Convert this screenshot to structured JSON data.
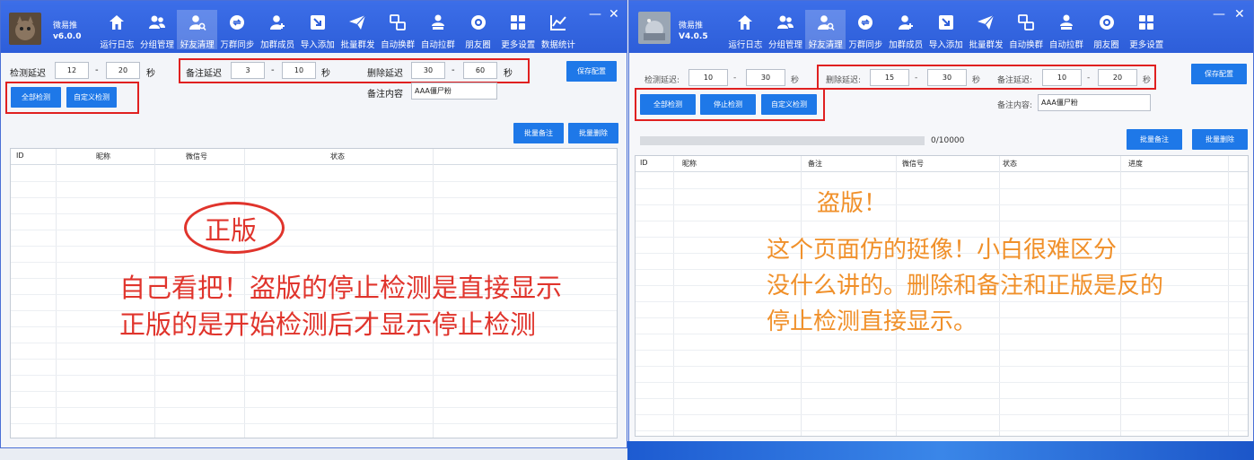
{
  "left": {
    "app_name": "微易推",
    "version": "v6.0.0",
    "nav": [
      "运行日志",
      "分组管理",
      "好友清理",
      "万群同步",
      "加群成员",
      "导入添加",
      "批量群发",
      "自动换群",
      "自动拉群",
      "朋友圈",
      "更多设置",
      "数据统计"
    ],
    "active_nav": "好友清理",
    "min": "—",
    "close": "✕",
    "check_delay_label": "检测延迟",
    "check_delay_from": "12",
    "check_delay_to": "20",
    "remark_delay_label": "备注延迟",
    "remark_delay_from": "3",
    "remark_delay_to": "10",
    "delete_delay_label": "删除延迟",
    "delete_delay_from": "30",
    "delete_delay_to": "60",
    "sec": "秒",
    "dash": "-",
    "save_btn": "保存配置",
    "check_all_btn": "全部检测",
    "custom_check_btn": "自定义检测",
    "remark_content_label": "备注内容",
    "remark_content_value": "AAA僵尸粉",
    "batch_remark_btn": "批量备注",
    "batch_delete_btn": "批量删除",
    "columns": [
      "ID",
      "昵称",
      "微信号",
      "状态"
    ],
    "ann_title": "正版",
    "ann_line1": "自己看把！盗版的停止检测是直接显示",
    "ann_line2": "正版的是开始检测后才显示停止检测"
  },
  "right": {
    "app_name": "微易推",
    "version": "V4.0.5",
    "nav": [
      "运行日志",
      "分组管理",
      "好友清理",
      "万群同步",
      "加群成员",
      "导入添加",
      "批量群发",
      "自动换群",
      "自动拉群",
      "朋友圈",
      "更多设置"
    ],
    "active_nav": "好友清理",
    "min": "—",
    "close": "✕",
    "check_delay_label": "检测延迟:",
    "check_delay_from": "10",
    "check_delay_to": "30",
    "delete_delay_label": "删除延迟:",
    "delete_delay_from": "15",
    "delete_delay_to": "30",
    "remark_delay_label": "备注延迟:",
    "remark_delay_from": "10",
    "remark_delay_to": "20",
    "sec": "秒",
    "dash": "-",
    "save_btn": "保存配置",
    "check_all_btn": "全部检测",
    "stop_check_btn": "停止检测",
    "custom_check_btn": "自定义检测",
    "remark_content_label": "备注内容:",
    "remark_content_value": "AAA僵尸粉",
    "progress_text": "0/10000",
    "progress": 0,
    "batch_remark_btn": "批量备注",
    "batch_delete_btn": "批量删除",
    "columns": [
      "ID",
      "昵称",
      "备注",
      "微信号",
      "状态",
      "进度"
    ],
    "ann_title": "盗版！",
    "ann_line1": "这个页面仿的挺像！小白很难区分",
    "ann_line2": "没什么讲的。删除和备注和正版是反的",
    "ann_line3": "停止检测直接显示。"
  },
  "colors": {
    "titlebar": "#2d5ed9",
    "button": "#1e78e8",
    "annotation_red": "#e0342c",
    "annotation_orange": "#f0902a"
  },
  "nav_icons": [
    "home-icon",
    "users-icon",
    "user-search-icon",
    "sync-icon",
    "add-user-icon",
    "import-icon",
    "send-icon",
    "swap-icon",
    "pull-icon",
    "camera-icon",
    "grid-icon",
    "chart-icon"
  ]
}
